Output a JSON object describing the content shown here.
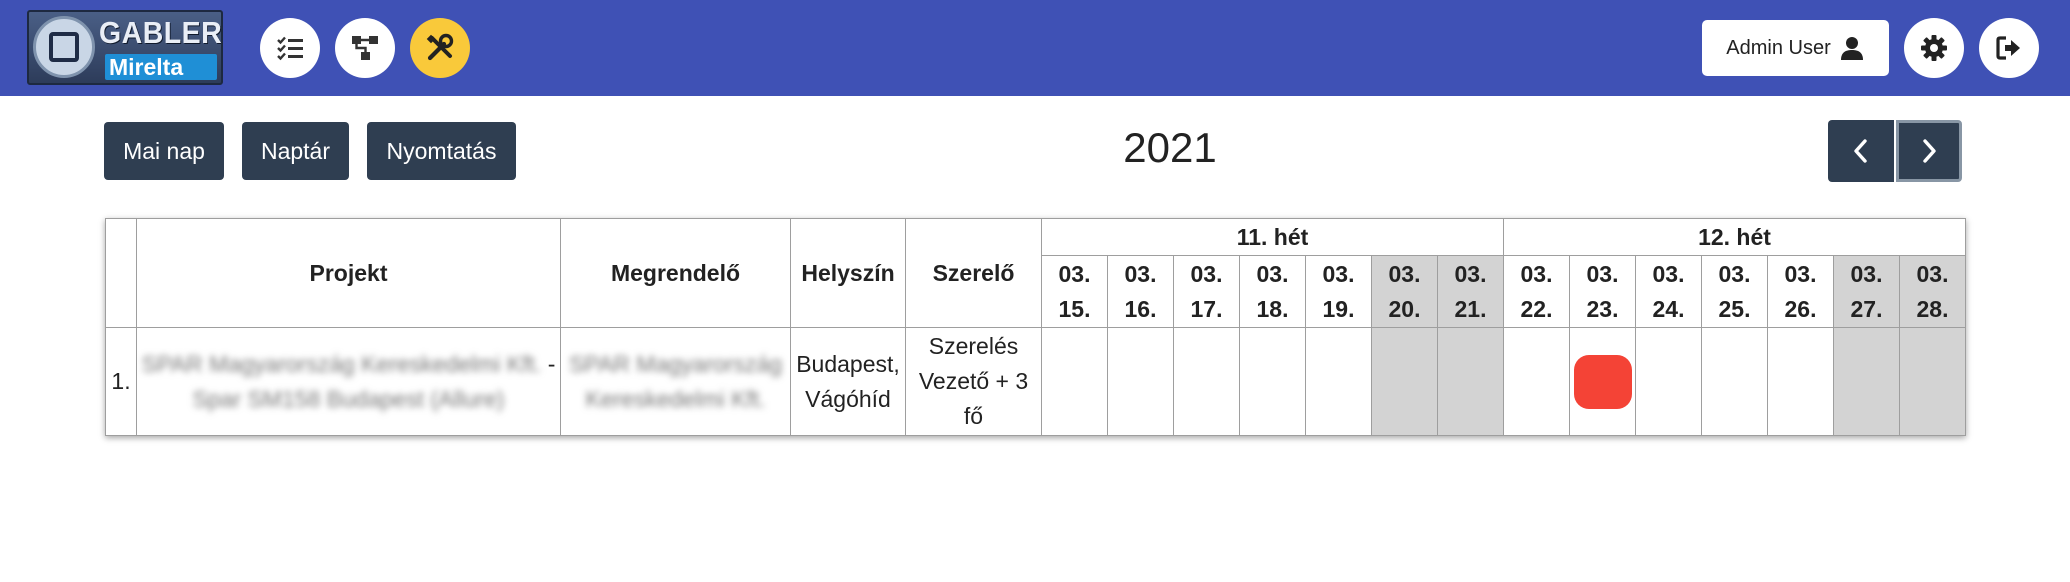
{
  "navbar": {
    "logo": {
      "brand": "GABLER",
      "sub": "Mirelta"
    },
    "nav_icons": [
      "checklist-icon",
      "hierarchy-icon",
      "tools-icon"
    ],
    "active_nav": "tools-icon",
    "user_label": "Admin User",
    "right_icons": [
      "gear-icon",
      "logout-icon"
    ]
  },
  "toolbar": {
    "today_label": "Mai nap",
    "calendar_label": "Naptár",
    "print_label": "Nyomtatás",
    "year": "2021"
  },
  "table": {
    "headers": {
      "index": "",
      "project": "Projekt",
      "client": "Megrendelő",
      "location": "Helyszín",
      "fitter": "Szerelő"
    },
    "weeks": [
      {
        "label": "11. hét",
        "days": [
          {
            "m": "03.",
            "d": "15.",
            "weekend": false
          },
          {
            "m": "03.",
            "d": "16.",
            "weekend": false
          },
          {
            "m": "03.",
            "d": "17.",
            "weekend": false
          },
          {
            "m": "03.",
            "d": "18.",
            "weekend": false
          },
          {
            "m": "03.",
            "d": "19.",
            "weekend": false
          },
          {
            "m": "03.",
            "d": "20.",
            "weekend": true
          },
          {
            "m": "03.",
            "d": "21.",
            "weekend": true
          }
        ]
      },
      {
        "label": "12. hét",
        "days": [
          {
            "m": "03.",
            "d": "22.",
            "weekend": false
          },
          {
            "m": "03.",
            "d": "23.",
            "weekend": false
          },
          {
            "m": "03.",
            "d": "24.",
            "weekend": false
          },
          {
            "m": "03.",
            "d": "25.",
            "weekend": false
          },
          {
            "m": "03.",
            "d": "26.",
            "weekend": false
          },
          {
            "m": "03.",
            "d": "27.",
            "weekend": true
          },
          {
            "m": "03.",
            "d": "28.",
            "weekend": true
          }
        ]
      }
    ],
    "rows": [
      {
        "index": "1.",
        "project_blurred_1": "SPAR Magyarország Kereskedelmi Kft.",
        "project_sep": "-",
        "project_blurred_2": "Spar SM158 Budapest (Allure)",
        "client_blurred_1": "SPAR Magyarország",
        "client_blurred_2": "Kereskedelmi Kft.",
        "location_1": "Budapest,",
        "location_2": "Vágóhíd",
        "fitter_1": "Szerelés",
        "fitter_2": "Vezető + 3",
        "fitter_3": "fő",
        "marked_day": "03. 23.",
        "marker_color": "#f44336"
      }
    ]
  },
  "colors": {
    "navbar": "#3f51b5",
    "active_nav": "#f9c93a",
    "dark_button": "#2f3e51",
    "weekend": "#d3d3d3"
  }
}
